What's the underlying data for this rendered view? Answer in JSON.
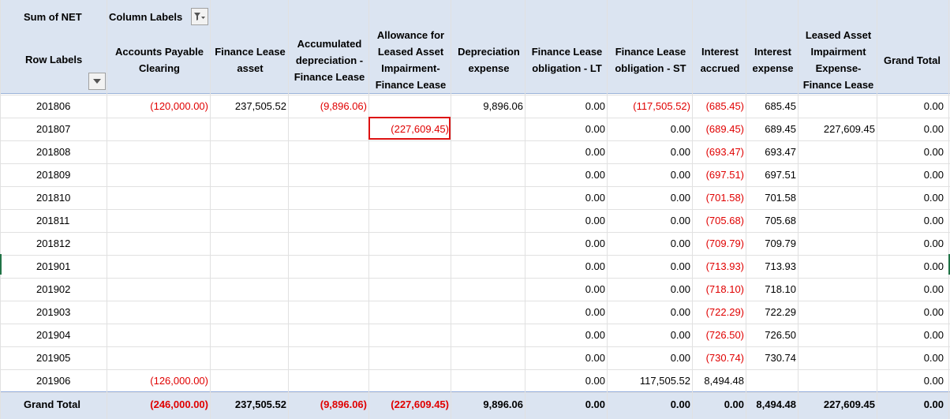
{
  "pivot": {
    "value_field_label": "Sum of NET",
    "column_labels_label": "Column Labels",
    "row_labels_label": "Row Labels",
    "grand_total_label": "Grand Total",
    "column_headers": [
      {
        "lines": [
          "Accounts Payable",
          "Clearing"
        ]
      },
      {
        "lines": [
          "Finance Lease",
          "asset"
        ]
      },
      {
        "lines": [
          "Accumulated",
          "depreciation -",
          "Finance Lease"
        ]
      },
      {
        "lines": [
          "Allowance for",
          "Leased Asset",
          "Impairment-",
          "Finance Lease"
        ]
      },
      {
        "lines": [
          "Depreciation",
          "expense"
        ]
      },
      {
        "lines": [
          "Finance Lease",
          "obligation - LT"
        ]
      },
      {
        "lines": [
          "Finance Lease",
          "obligation - ST"
        ]
      },
      {
        "lines": [
          "Interest",
          "accrued"
        ]
      },
      {
        "lines": [
          "Interest",
          "expense"
        ]
      },
      {
        "lines": [
          "Leased Asset",
          "Impairment",
          "Expense-",
          "Finance Lease"
        ]
      },
      {
        "lines": [
          "Grand Total"
        ]
      }
    ],
    "rows": [
      {
        "label": "201806",
        "cells": [
          "(120,000.00)",
          "237,505.52",
          "(9,896.06)",
          "",
          "9,896.06",
          "0.00",
          "(117,505.52)",
          "(685.45)",
          "685.45",
          "",
          "0.00"
        ]
      },
      {
        "label": "201807",
        "cells": [
          "",
          "",
          "",
          "(227,609.45)",
          "",
          "0.00",
          "0.00",
          "(689.45)",
          "689.45",
          "227,609.45",
          "0.00"
        ]
      },
      {
        "label": "201808",
        "cells": [
          "",
          "",
          "",
          "",
          "",
          "0.00",
          "0.00",
          "(693.47)",
          "693.47",
          "",
          "0.00"
        ]
      },
      {
        "label": "201809",
        "cells": [
          "",
          "",
          "",
          "",
          "",
          "0.00",
          "0.00",
          "(697.51)",
          "697.51",
          "",
          "0.00"
        ]
      },
      {
        "label": "201810",
        "cells": [
          "",
          "",
          "",
          "",
          "",
          "0.00",
          "0.00",
          "(701.58)",
          "701.58",
          "",
          "0.00"
        ]
      },
      {
        "label": "201811",
        "cells": [
          "",
          "",
          "",
          "",
          "",
          "0.00",
          "0.00",
          "(705.68)",
          "705.68",
          "",
          "0.00"
        ]
      },
      {
        "label": "201812",
        "cells": [
          "",
          "",
          "",
          "",
          "",
          "0.00",
          "0.00",
          "(709.79)",
          "709.79",
          "",
          "0.00"
        ]
      },
      {
        "label": "201901",
        "cells": [
          "",
          "",
          "",
          "",
          "",
          "0.00",
          "0.00",
          "(713.93)",
          "713.93",
          "",
          "0.00"
        ]
      },
      {
        "label": "201902",
        "cells": [
          "",
          "",
          "",
          "",
          "",
          "0.00",
          "0.00",
          "(718.10)",
          "718.10",
          "",
          "0.00"
        ]
      },
      {
        "label": "201903",
        "cells": [
          "",
          "",
          "",
          "",
          "",
          "0.00",
          "0.00",
          "(722.29)",
          "722.29",
          "",
          "0.00"
        ]
      },
      {
        "label": "201904",
        "cells": [
          "",
          "",
          "",
          "",
          "",
          "0.00",
          "0.00",
          "(726.50)",
          "726.50",
          "",
          "0.00"
        ]
      },
      {
        "label": "201905",
        "cells": [
          "",
          "",
          "",
          "",
          "",
          "0.00",
          "0.00",
          "(730.74)",
          "730.74",
          "",
          "0.00"
        ]
      },
      {
        "label": "201906",
        "cells": [
          "(126,000.00)",
          "",
          "",
          "",
          "",
          "0.00",
          "117,505.52",
          "8,494.48",
          "",
          "",
          "0.00"
        ]
      }
    ],
    "grand_total_row": [
      "(246,000.00)",
      "237,505.52",
      "(9,896.06)",
      "(227,609.45)",
      "9,896.06",
      "0.00",
      "0.00",
      "0.00",
      "8,494.48",
      "227,609.45",
      "0.00"
    ]
  },
  "colors": {
    "header_band": "#dbe4f1",
    "negative_text": "#e00000",
    "highlight_box": "#d11111"
  },
  "icons": {
    "column_filter": "filter-dropdown-icon",
    "row_labels_dropdown": "dropdown-arrow-icon"
  }
}
